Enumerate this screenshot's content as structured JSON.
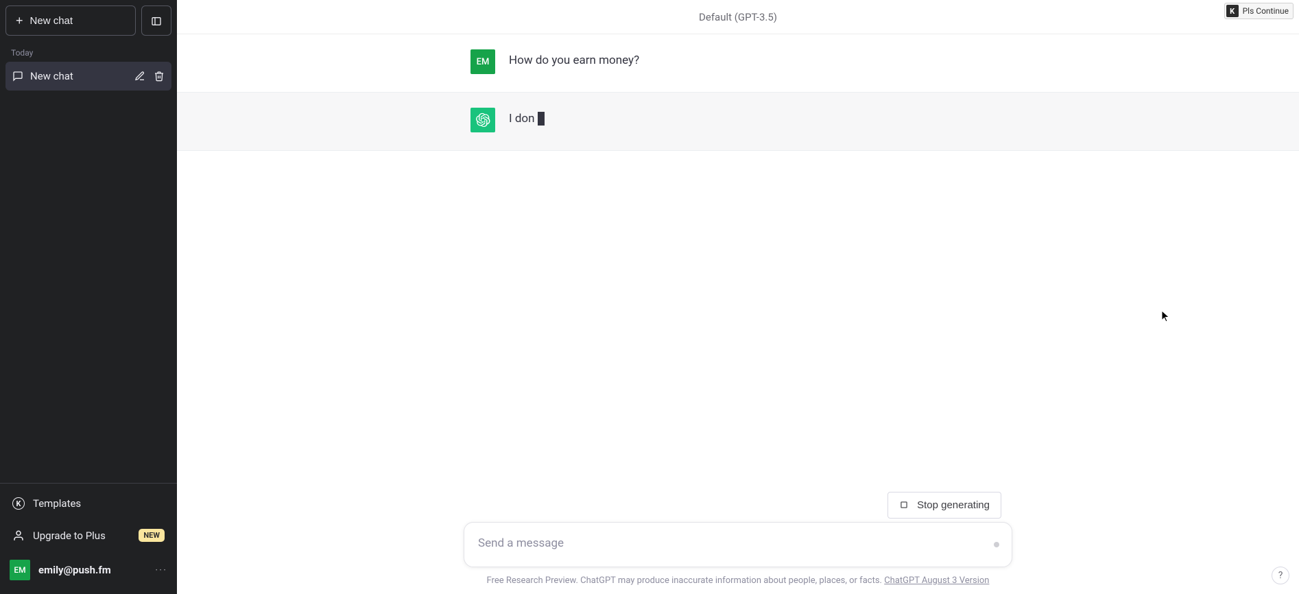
{
  "sidebar": {
    "newchat_label": "New chat",
    "section_today": "Today",
    "history": [
      {
        "title": "New chat"
      }
    ],
    "templates_label": "Templates",
    "upgrade_label": "Upgrade to Plus",
    "upgrade_badge": "NEW",
    "user": {
      "initials": "EM",
      "email": "emily@push.fm"
    }
  },
  "header": {
    "model": "Default (GPT-3.5)",
    "extension_label": "Pls Continue",
    "extension_badge": "K"
  },
  "messages": [
    {
      "role": "user",
      "avatar": "EM",
      "text": "How do you earn money?"
    },
    {
      "role": "assistant",
      "text": "I don",
      "streaming": true
    }
  ],
  "composer": {
    "placeholder": "Send a message",
    "value": "",
    "stop_label": "Stop generating"
  },
  "footer": {
    "disclaimer_prefix": "Free Research Preview. ChatGPT may produce inaccurate information about people, places, or facts. ",
    "version_link": "ChatGPT August 3 Version"
  },
  "help_icon": "?"
}
